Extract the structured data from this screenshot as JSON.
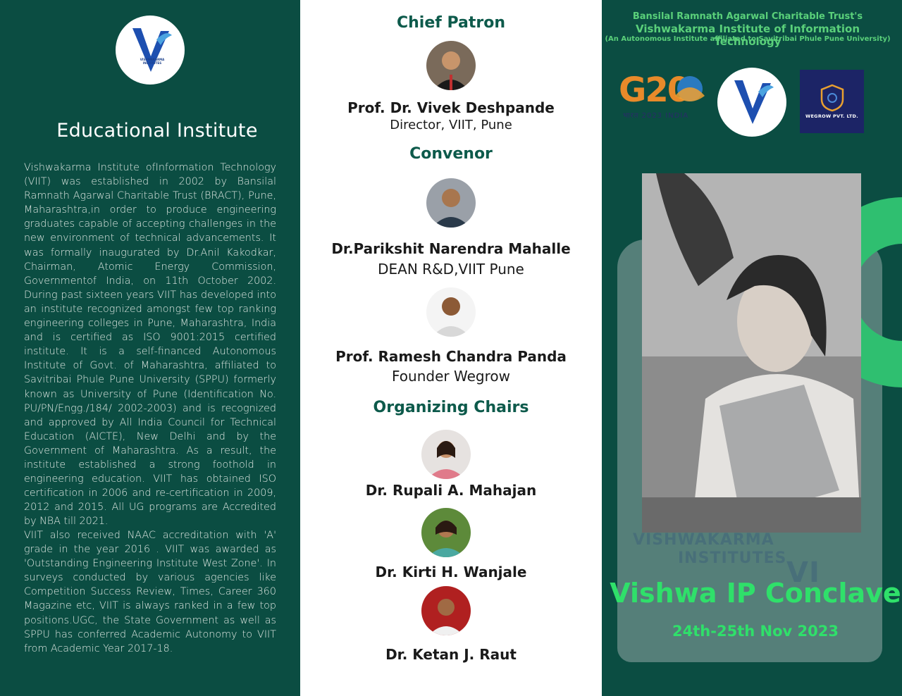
{
  "left": {
    "logo": {
      "text": "VISHWAKARMA INSTITUTES",
      "letters": "VI"
    },
    "heading": "Educational Institute",
    "para1": "Vishwakarma Institute ofInformation Technology (VIIT) was established in 2002 by Bansilal Ramnath Agarwal Charitable Trust (BRACT), Pune, Maharashtra,in order to produce engineering graduates capable of accepting challenges in the new environment of technical advancements. It was formally inaugurated by Dr.Anil Kakodkar, Chairman, Atomic Energy Commission, Governmentof India, on 11th October 2002. During past sixteen years VIIT has developed into an institute recognized amongst few top ranking engineering colleges in Pune, Maharashtra, India and is certified as ISO 9001:2015 certified institute. It is a self-financed Autonomous Institute of Govt. of Maharashtra, affiliated to Savitribai Phule Pune University (SPPU) formerly known as University of Pune (Identification No. PU/PN/Engg./184/ 2002-2003) and is recognized and approved by All India Council for Technical Education (AICTE), New Delhi and by the Government of Maharashtra. As a result, the institute established a strong foothold in engineering education. VIIT has obtained ISO certification in 2006 and re-certification in 2009, 2012 and 2015. All UG programs are Accredited by NBA till 2021.",
    "para2": "VIIT also received NAAC accreditation with 'A' grade in the year 2016 . VIIT was awarded as 'Outstanding Engineering Institute West Zone'. In surveys conducted by various agencies like Competition Success Review, Times, Career 360 Magazine etc, VIIT is always ranked in a few top positions.UGC, the State Government as well as SPPU has conferred Academic Autonomy to VIIT from Academic Year 2017-18."
  },
  "middle": {
    "chief_patron": {
      "title": "Chief Patron",
      "name": "Prof. Dr. Vivek Deshpande",
      "role": "Director, VIIT, Pune"
    },
    "convenor": {
      "title": "Convenor",
      "people": [
        {
          "name": "Dr.Parikshit Narendra Mahalle",
          "role": "DEAN R&D,VIIT Pune"
        },
        {
          "name": "Prof. Ramesh Chandra Panda",
          "role": "Founder Wegrow"
        }
      ]
    },
    "organizing_chairs": {
      "title": "Organizing Chairs",
      "people": [
        {
          "name": "Dr. Rupali A. Mahajan"
        },
        {
          "name": "Dr. Kirti H. Wanjale"
        },
        {
          "name": "Dr. Ketan J. Raut"
        }
      ]
    }
  },
  "right": {
    "trust": "Bansilal Ramnath Agarwal Charitable Trust's",
    "institute": "Vishwakarma Institute of Information Technology",
    "affiliation": "(An Autonomous Institute affiliated to Savitribai Phule Pune University)",
    "g20": {
      "text": "G20",
      "sub": "भारत 2023 INDIA"
    },
    "wegrow": {
      "name": "WEGROW PVT. LTD."
    },
    "watermark": {
      "line1": "VISHWAKARMA",
      "line2": "INSTITUTES",
      "letters": "VI"
    },
    "event_title": "Vishwa IP Conclave",
    "event_dates": "24th-25th Nov 2023"
  },
  "colors": {
    "panel_green": "#0b4d42",
    "title_green": "#0d5a4b",
    "accent_green": "#2fe06a",
    "header_green": "#5ad07a"
  },
  "icons": [
    "vi-logo-icon",
    "g20-logo-icon",
    "wegrow-logo-icon",
    "avatar-photo"
  ]
}
